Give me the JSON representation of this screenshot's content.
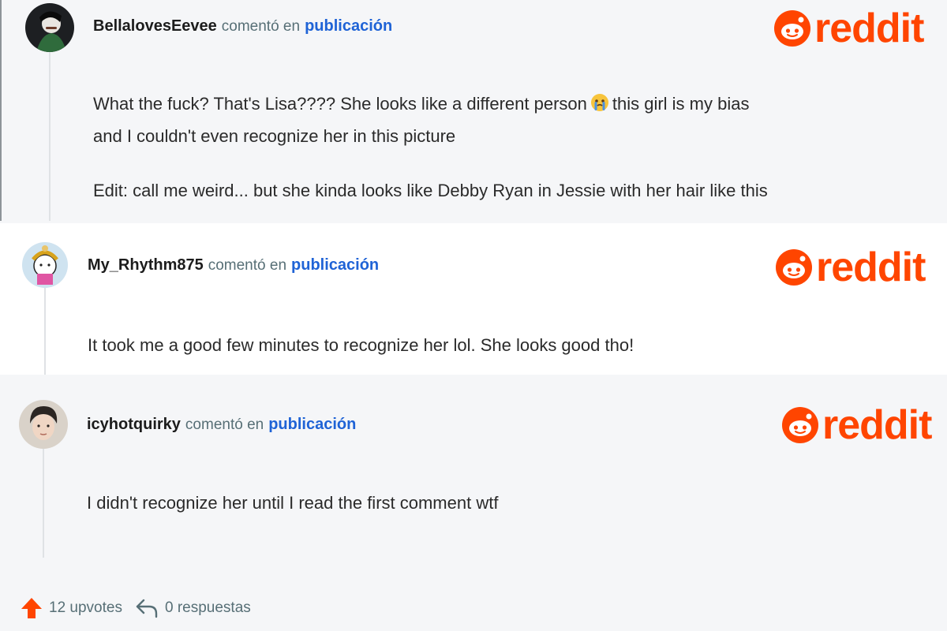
{
  "brand": {
    "word": "reddit",
    "color": "#ff4500"
  },
  "comments": [
    {
      "username": "BellalovesEevee",
      "commented": "comentó en",
      "post_link": "publicación",
      "lines": [
        "What the fuck? That's Lisa???? She looks like a different person {emoji} this girl is my bias",
        "and I couldn't even recognize her in this picture",
        "",
        "Edit: call me weird... but she kinda looks like Debby Ryan in Jessie with her hair like this"
      ],
      "text_part1": "What the fuck? That's Lisa???? She looks like a different person",
      "text_part2": "this girl is my bias",
      "text_line2": "and I couldn't even recognize her in this picture",
      "text_edit": "Edit: call me weird... but she kinda looks like Debby Ryan in Jessie with her hair like this",
      "emoji": "crying-face-icon"
    },
    {
      "username": "My_Rhythm875",
      "commented": "comentó en",
      "post_link": "publicación",
      "text": "It took me a good few minutes to recognize her lol. She looks good tho!"
    },
    {
      "username": "icyhotquirky",
      "commented": "comentó en",
      "post_link": "publicación",
      "text": "I didn't recognize her until I read the first comment wtf"
    }
  ],
  "footer": {
    "upvotes_label": "12 upvotes",
    "replies_label": "0 respuestas",
    "upvote_icon": "arrow-up-icon",
    "reply_icon": "reply-arrow-icon"
  }
}
